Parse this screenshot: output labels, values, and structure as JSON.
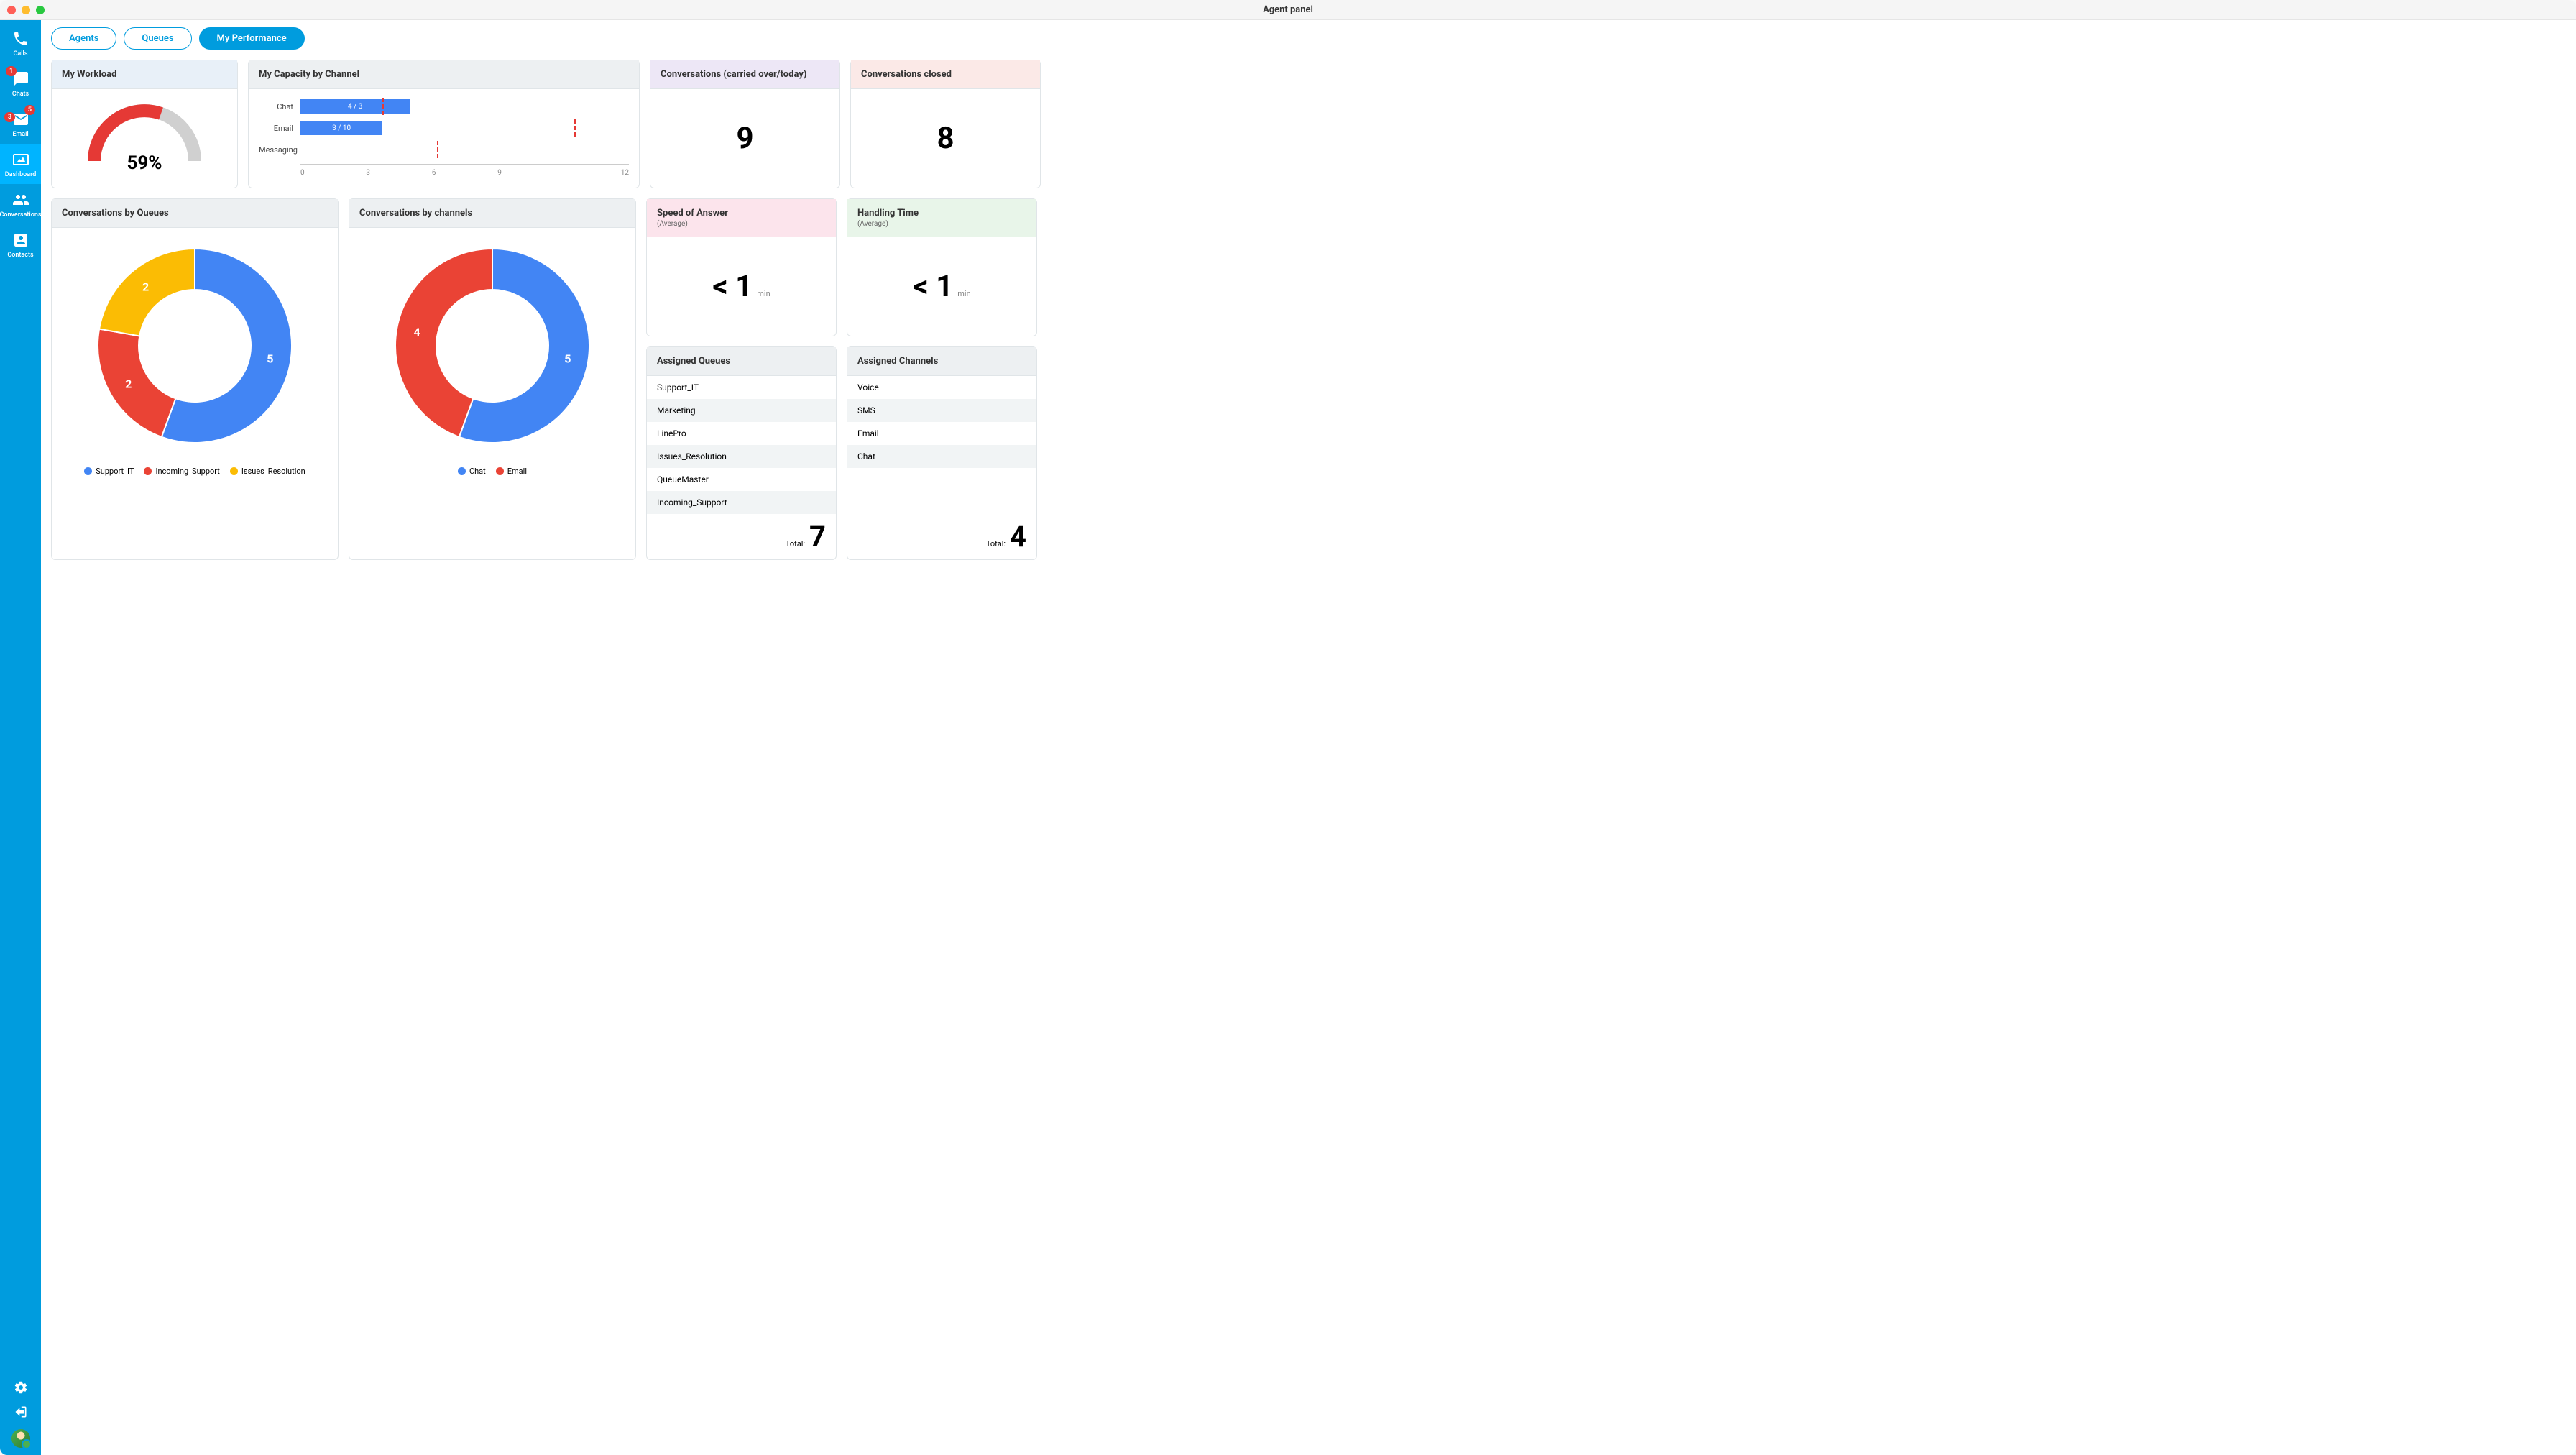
{
  "window_title": "Agent panel",
  "sidebar": {
    "items": [
      {
        "label": "Calls",
        "icon": "phone",
        "badge": null,
        "active": false
      },
      {
        "label": "Chats",
        "icon": "chat",
        "badge": "1",
        "active": false
      },
      {
        "label": "Email",
        "icon": "email",
        "badge_top": "5",
        "badge_left": "3",
        "active": false
      },
      {
        "label": "Dashboard",
        "icon": "dashboard",
        "badge": null,
        "active": true
      },
      {
        "label": "Conversations",
        "icon": "conversations",
        "badge": null,
        "active": false
      },
      {
        "label": "Contacts",
        "icon": "contacts",
        "badge": null,
        "active": false
      }
    ]
  },
  "tabs": [
    {
      "label": "Agents",
      "active": false
    },
    {
      "label": "Queues",
      "active": false
    },
    {
      "label": "My Performance",
      "active": true
    }
  ],
  "workload": {
    "title": "My Workload",
    "percent_label": "59%",
    "percent": 59
  },
  "capacity": {
    "title": "My Capacity by Channel",
    "axis_max": 12,
    "rows": [
      {
        "label": "Chat",
        "value": 4,
        "cap": 3,
        "text": "4 / 3"
      },
      {
        "label": "Email",
        "value": 3,
        "cap": 10,
        "text": "3 / 10"
      },
      {
        "label": "Messaging",
        "value": 0,
        "cap": 5,
        "text": ""
      }
    ],
    "ticks": [
      "0",
      "3",
      "6",
      "9",
      "12"
    ]
  },
  "carried": {
    "title": "Conversations (carried over/today)",
    "value": "9"
  },
  "closed": {
    "title": "Conversations closed",
    "value": "8"
  },
  "convo_queues": {
    "title": "Conversations by Queues",
    "series": [
      {
        "name": "Support_IT",
        "value": 5,
        "color": "#4285f4"
      },
      {
        "name": "Incoming_Support",
        "value": 2,
        "color": "#ea4335"
      },
      {
        "name": "Issues_Resolution",
        "value": 2,
        "color": "#fbbc04"
      }
    ]
  },
  "convo_channels": {
    "title": "Conversations by channels",
    "series": [
      {
        "name": "Chat",
        "value": 5,
        "color": "#4285f4"
      },
      {
        "name": "Email",
        "value": 4,
        "color": "#ea4335"
      }
    ]
  },
  "speed": {
    "title": "Speed of Answer",
    "subtitle": "(Average)",
    "value": "< 1",
    "unit": "min"
  },
  "handling": {
    "title": "Handling Time",
    "subtitle": "(Average)",
    "value": "< 1",
    "unit": "min"
  },
  "assigned_queues": {
    "title": "Assigned Queues",
    "items": [
      "Support_IT",
      "Marketing",
      "LinePro",
      "Issues_Resolution",
      "QueueMaster",
      "Incoming_Support"
    ],
    "total_label": "Total:",
    "total": "7"
  },
  "assigned_channels": {
    "title": "Assigned Channels",
    "items": [
      "Voice",
      "SMS",
      "Email",
      "Chat"
    ],
    "total_label": "Total:",
    "total": "4"
  },
  "chart_data": [
    {
      "type": "bar",
      "title": "My Capacity by Channel",
      "categories": [
        "Chat",
        "Email",
        "Messaging"
      ],
      "series": [
        {
          "name": "current",
          "values": [
            4,
            3,
            0
          ]
        },
        {
          "name": "capacity",
          "values": [
            3,
            10,
            5
          ]
        }
      ],
      "xlim": [
        0,
        12
      ]
    },
    {
      "type": "pie",
      "title": "Conversations by Queues",
      "categories": [
        "Support_IT",
        "Incoming_Support",
        "Issues_Resolution"
      ],
      "values": [
        5,
        2,
        2
      ]
    },
    {
      "type": "pie",
      "title": "Conversations by channels",
      "categories": [
        "Chat",
        "Email"
      ],
      "values": [
        5,
        4
      ]
    },
    {
      "type": "bar",
      "title": "My Workload",
      "categories": [
        "workload"
      ],
      "values": [
        59
      ],
      "ylim": [
        0,
        100
      ]
    }
  ]
}
